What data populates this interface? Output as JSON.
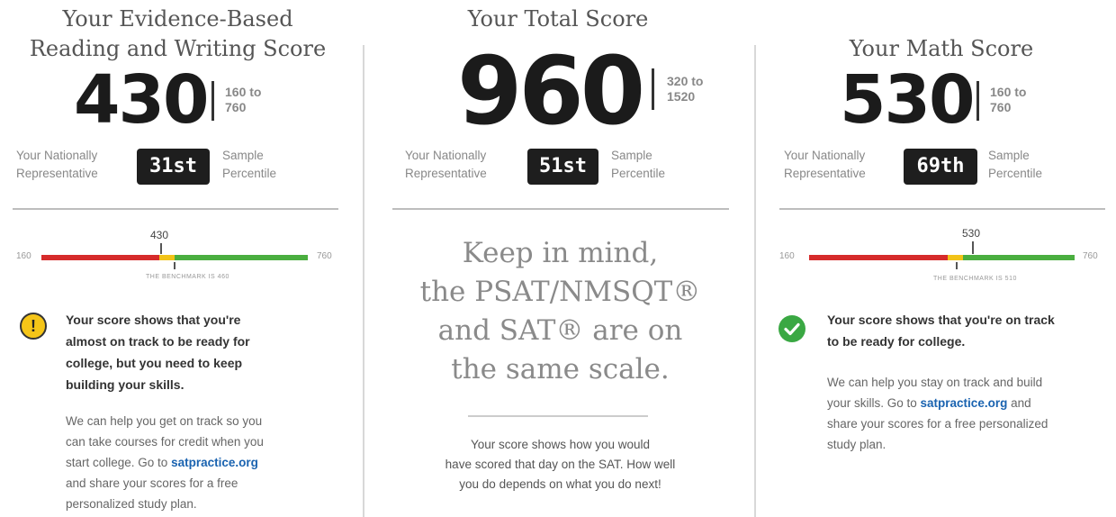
{
  "reading": {
    "heading_line1": "Your Evidence-Based",
    "heading_line2": "Reading and Writing Score",
    "score": "430",
    "range_line1": "160 to",
    "range_line2": "760",
    "pctl_left_1": "Your Nationally",
    "pctl_left_2": "Representative",
    "percentile": "31st",
    "pctl_right_1": "Sample",
    "pctl_right_2": "Percentile",
    "bar_min": "160",
    "bar_max": "760",
    "marker_value": "430",
    "marker_fraction": 0.45,
    "benchmark_text": "THE BENCHMARK IS 460",
    "status_icon": "warning-icon",
    "status_color": "#f5c518",
    "status_line1": "Your score shows that you're",
    "status_line2": "almost on track to be ready for",
    "status_line3": "college, but you need to keep",
    "status_line4": "building your skills.",
    "help_line1": "We can help you get on track so you",
    "help_line2": "can take courses for credit when you",
    "help_line3_pre": "start college. Go to ",
    "help_link": "satpractice.org",
    "help_line4": "and share your scores for a free",
    "help_line5": "personalized study plan."
  },
  "total": {
    "heading": "Your Total Score",
    "score": "960",
    "range_line1": "320 to",
    "range_line2": "1520",
    "pctl_left_1": "Your Nationally",
    "pctl_left_2": "Representative",
    "percentile": "51st",
    "pctl_right_1": "Sample",
    "pctl_right_2": "Percentile",
    "keep_line1": "Keep in mind,",
    "keep_line2": "the PSAT/NMSQT®",
    "keep_line3": "and SAT® are on",
    "keep_line4": "the same scale.",
    "note_line1": "Your score shows how you would",
    "note_line2": "have scored that day on the SAT. How well",
    "note_line3": "you do depends on what you do next!"
  },
  "math": {
    "heading": "Your Math Score",
    "score": "530",
    "range_line1": "160 to",
    "range_line2": "760",
    "pctl_left_1": "Your Nationally",
    "pctl_left_2": "Representative",
    "percentile": "69th",
    "pctl_right_1": "Sample",
    "pctl_right_2": "Percentile",
    "bar_min": "160",
    "bar_max": "760",
    "marker_value": "530",
    "marker_fraction": 0.617,
    "benchmark_text": "THE BENCHMARK IS 510",
    "status_icon": "check-circle-icon",
    "status_color": "#3aa843",
    "status_line1": "Your score shows that you're on track",
    "status_line2": "to be ready for college.",
    "help_line1": "We can help you stay on track and build",
    "help_line2_pre": "your skills. Go to ",
    "help_link": "satpractice.org",
    "help_line2_post": " and",
    "help_line3": "share your scores for a free personalized",
    "help_line4": "study plan."
  },
  "colors": {
    "bar_red": "#d62b2b",
    "bar_yellow": "#f2c318",
    "bar_green": "#4aae3f",
    "link": "#1a63b0"
  }
}
